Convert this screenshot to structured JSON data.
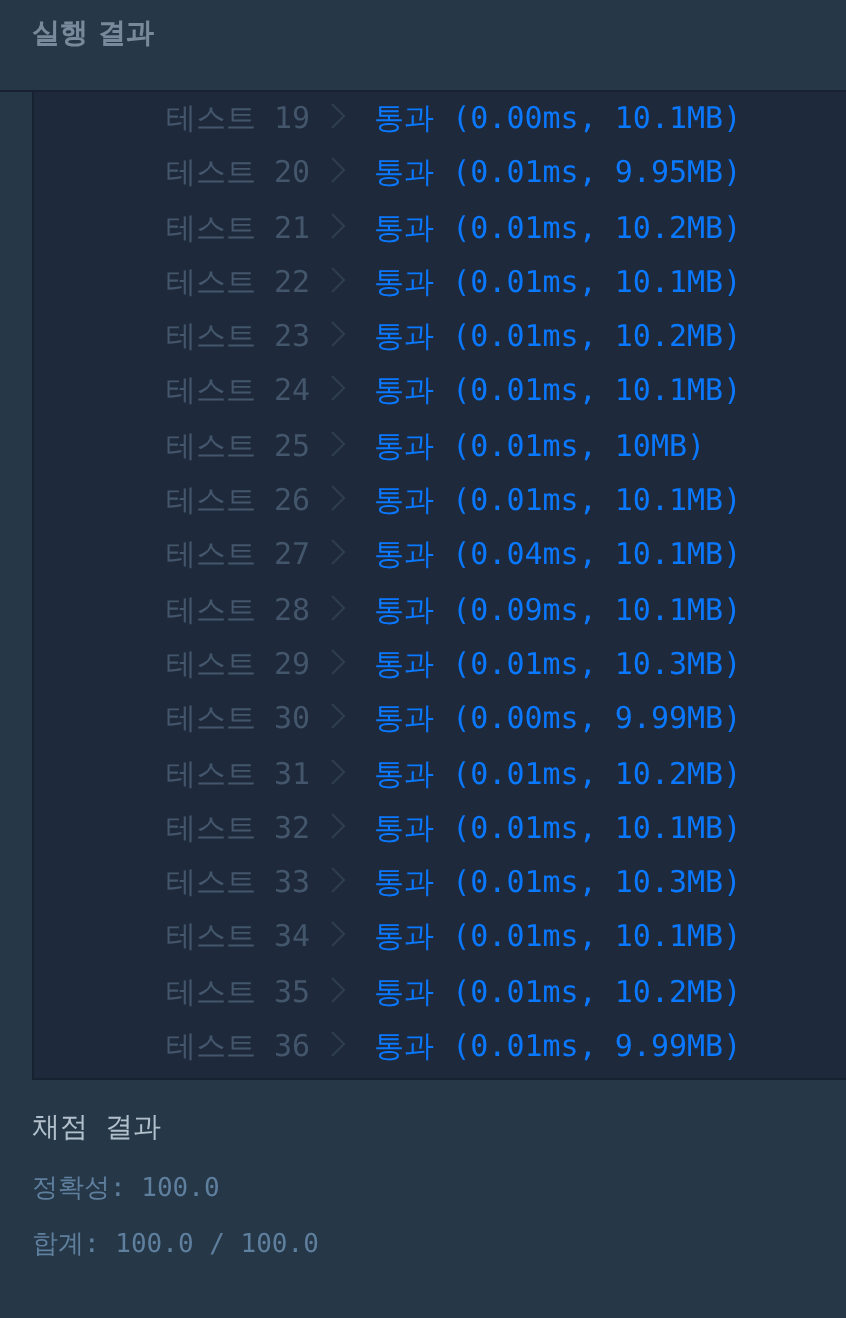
{
  "header": {
    "title": "실행 결과"
  },
  "results": [
    {
      "test": "테스트 19",
      "result": "통과 (0.00ms, 10.1MB)"
    },
    {
      "test": "테스트 20",
      "result": "통과 (0.01ms, 9.95MB)"
    },
    {
      "test": "테스트 21",
      "result": "통과 (0.01ms, 10.2MB)"
    },
    {
      "test": "테스트 22",
      "result": "통과 (0.01ms, 10.1MB)"
    },
    {
      "test": "테스트 23",
      "result": "통과 (0.01ms, 10.2MB)"
    },
    {
      "test": "테스트 24",
      "result": "통과 (0.01ms, 10.1MB)"
    },
    {
      "test": "테스트 25",
      "result": "통과 (0.01ms, 10MB)"
    },
    {
      "test": "테스트 26",
      "result": "통과 (0.01ms, 10.1MB)"
    },
    {
      "test": "테스트 27",
      "result": "통과 (0.04ms, 10.1MB)"
    },
    {
      "test": "테스트 28",
      "result": "통과 (0.09ms, 10.1MB)"
    },
    {
      "test": "테스트 29",
      "result": "통과 (0.01ms, 10.3MB)"
    },
    {
      "test": "테스트 30",
      "result": "통과 (0.00ms, 9.99MB)"
    },
    {
      "test": "테스트 31",
      "result": "통과 (0.01ms, 10.2MB)"
    },
    {
      "test": "테스트 32",
      "result": "통과 (0.01ms, 10.1MB)"
    },
    {
      "test": "테스트 33",
      "result": "통과 (0.01ms, 10.3MB)"
    },
    {
      "test": "테스트 34",
      "result": "통과 (0.01ms, 10.1MB)"
    },
    {
      "test": "테스트 35",
      "result": "통과 (0.01ms, 10.2MB)"
    },
    {
      "test": "테스트 36",
      "result": "통과 (0.01ms, 9.99MB)"
    }
  ],
  "grading": {
    "title": "채점 결과",
    "accuracy": "정확성: 100.0",
    "total": "합계: 100.0 / 100.0"
  }
}
